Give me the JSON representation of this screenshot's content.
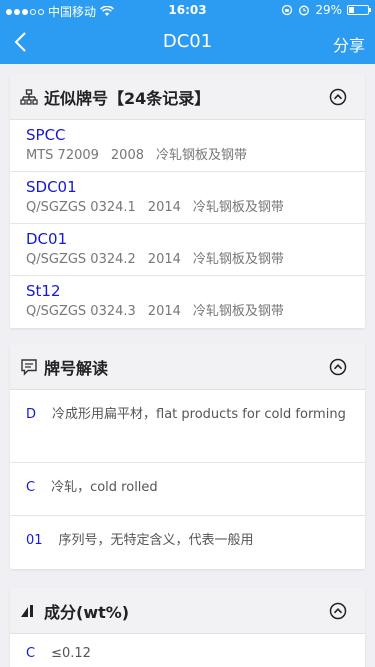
{
  "status": {
    "carrier": "中国移动",
    "time": "16:03",
    "battery": "29%",
    "battery_level": 0.29
  },
  "nav": {
    "title": "DC01",
    "share": "分享"
  },
  "similar": {
    "title": "近似牌号【24条记录】",
    "items": [
      {
        "name": "SPCC",
        "standard": "MTS 72009",
        "year": "2008",
        "category": "冷轧钢板及钢带"
      },
      {
        "name": "SDC01",
        "standard": "Q/SGZGS 0324.1",
        "year": "2014",
        "category": "冷轧钢板及钢带"
      },
      {
        "name": "DC01",
        "standard": "Q/SGZGS 0324.2",
        "year": "2014",
        "category": "冷轧钢板及钢带"
      },
      {
        "name": "St12",
        "standard": "Q/SGZGS 0324.3",
        "year": "2014",
        "category": "冷轧钢板及钢带"
      }
    ]
  },
  "interpretation": {
    "title": "牌号解读",
    "items": [
      {
        "code": "D",
        "text": "冷成形用扁平材，flat products for cold forming"
      },
      {
        "code": "C",
        "text": "冷轧，cold rolled"
      },
      {
        "code": "01",
        "text": "序列号，无特定含义，代表一般用"
      }
    ]
  },
  "composition": {
    "title": "成分(wt%)",
    "first_row": {
      "element": "C",
      "value": "≤0.12"
    }
  },
  "colors": {
    "accent": "#2c9cf2",
    "link": "#1717d6"
  }
}
